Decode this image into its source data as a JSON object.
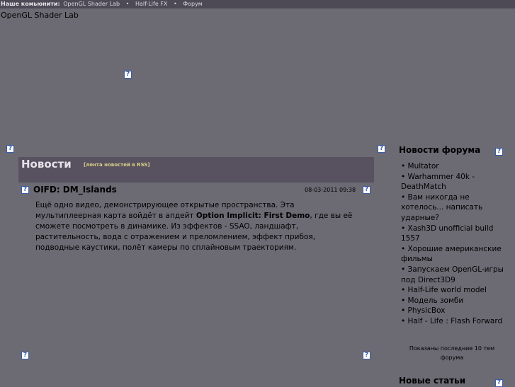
{
  "topbar": {
    "label": "Наше комьюнити:",
    "links": [
      "OpenGL Shader Lab",
      "Half-Life FX",
      "Форум"
    ],
    "separator": "•"
  },
  "site": {
    "title": "OpenGL Shader Lab"
  },
  "icon": {
    "name": "broken-image-icon",
    "glyph": "?"
  },
  "news": {
    "heading": "Новости",
    "rss_link": "[лента новостей в RSS]",
    "article": {
      "title": "OIFD: DM_Islands",
      "date": "08-03-2011 09:38",
      "body_part1": "Ещё одно видео, демонстрирующее открытые пространства. Эта мультиплеерная карта войдёт в апдейт ",
      "body_bold": "Option Implicit: First Demo",
      "body_part2": ", где вы её сможете посмотреть в динамике. Из эффектов - SSAO, ландшафт, растительность, вода с отражением и преломлением, эффект прибоя, подводные каустики, полёт камеры по сплайновым траекториям."
    }
  },
  "forum": {
    "title": "Новости форума",
    "items": [
      "Multator",
      "Warhammer 40k - DeathMatch",
      "Вам никогда не хотелось... написать ударные?",
      "Xash3D unofficial build 1557",
      "Хорошие американские фильмы",
      "Запускаем OpenGL-игры под Direct3D9",
      "Half-Life world model",
      "Модель зомби",
      "PhysicBox",
      "Half - Life : Flash Forward"
    ],
    "note": "Показаны последние 10 тем форума"
  },
  "articles": {
    "title": "Новые статьи"
  },
  "colors": {
    "background": "#6c6a73",
    "topbar": "#4e4a55",
    "news_header": "#585260",
    "rss_link": "#d9cf86",
    "icon_border": "#3a5ea8"
  }
}
